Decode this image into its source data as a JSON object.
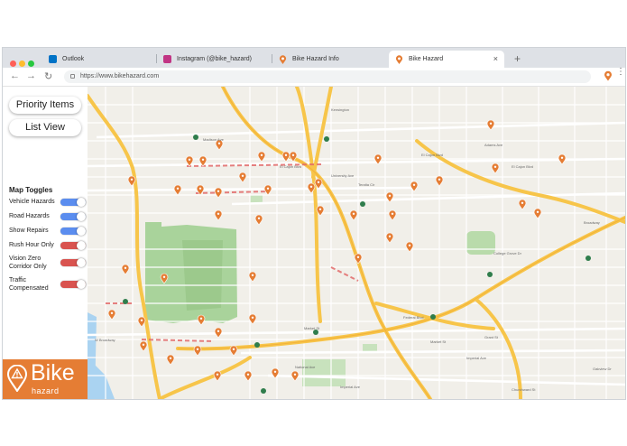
{
  "browser": {
    "tabs": [
      {
        "title": "Outlook",
        "icon": "outlook-icon",
        "color": "#0072c6"
      },
      {
        "title": "Instagram (@bike_hazard)",
        "icon": "instagram-icon",
        "color": "#c13584"
      },
      {
        "title": "Bike Hazard Info",
        "icon": "map-pin-icon",
        "color": "#e57d34"
      },
      {
        "title": "Bike Hazard",
        "icon": "map-pin-icon",
        "color": "#e57d34"
      }
    ],
    "close_glyph": "×",
    "new_tab_glyph": "+",
    "url": "https://www.bikehazard.com",
    "nav": {
      "back": "←",
      "forward": "→",
      "reload": "↻"
    },
    "menu_glyph": "⋮"
  },
  "sidebar": {
    "priority_button": "Priority Items",
    "list_button": "List View",
    "toggles_title": "Map Toggles",
    "toggles": [
      {
        "label": "Vehicle Hazards",
        "on": true
      },
      {
        "label": "Road Hazards",
        "on": true
      },
      {
        "label": "Show Repairs",
        "on": true
      },
      {
        "label": "Rush Hour Only",
        "on": false
      },
      {
        "label": "Vision Zero Corridor Only",
        "on": false
      },
      {
        "label": "Traffic Compensated",
        "on": false
      }
    ],
    "logo": {
      "word": "Bike",
      "sub": "hazard"
    }
  },
  "colors": {
    "toggle_on": "#5b8def",
    "toggle_off": "#d9534f",
    "brand_orange": "#e57d34",
    "freeway": "#f7c54a",
    "park": "#a9d39b",
    "water": "#aad3f1"
  },
  "map": {
    "streets": [
      "Madison Ave",
      "Adams Ave",
      "El Cajon Blvd",
      "El Cajon Blvd",
      "University Ave",
      "Teralta Cir",
      "El Cajon Blvd",
      "Broadway",
      "College Grove Dr",
      "Federal Blvd",
      "Market St",
      "Imperial Ave",
      "Churchward St",
      "Kensington",
      "Grant St",
      "Oakview Dr",
      "W Broadway",
      "Market St",
      "National Ave",
      "Imperial Ave"
    ]
  }
}
